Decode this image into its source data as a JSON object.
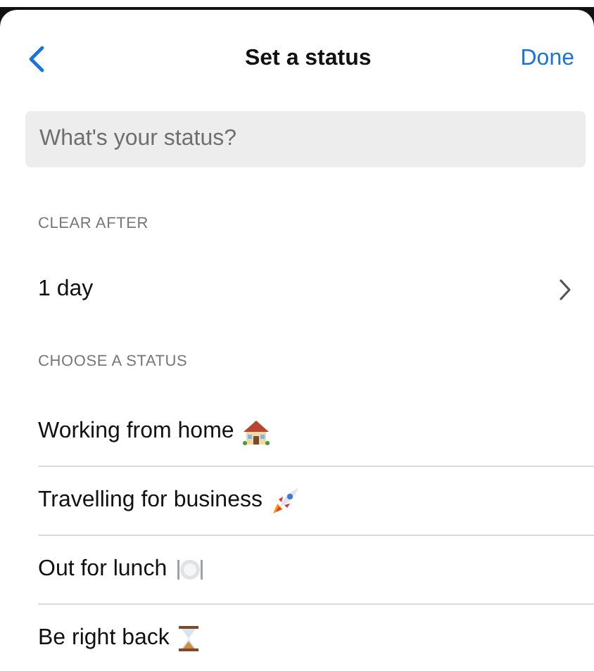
{
  "header": {
    "title": "Set a status",
    "done": "Done"
  },
  "status_field": {
    "placeholder": "What's your status?"
  },
  "clear_after": {
    "heading": "CLEAR AFTER",
    "value": "1 day"
  },
  "choose": {
    "heading": "CHOOSE A STATUS",
    "items": [
      {
        "label": "Working from home",
        "kind": "house"
      },
      {
        "label": "Travelling for business",
        "kind": "rocket"
      },
      {
        "label": "Out for lunch",
        "kind": "plate"
      },
      {
        "label": "Be right back",
        "kind": "hourglass"
      }
    ]
  }
}
